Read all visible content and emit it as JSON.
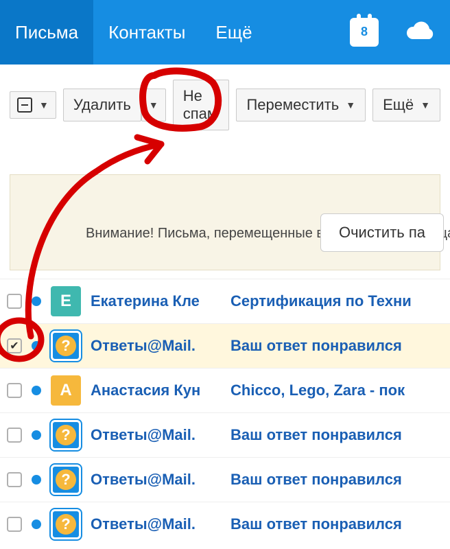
{
  "topnav": {
    "mails": "Письма",
    "contacts": "Контакты",
    "more": "Ещё",
    "calendar_day": "8"
  },
  "toolbar": {
    "delete_label": "Удалить",
    "notspam_label": "Не спам",
    "move_label": "Переместить",
    "more_label": "Ещё"
  },
  "panel": {
    "clear_label": "Очистить па",
    "warning": "Внимание! Письма, перемещенные в Спам более месяца"
  },
  "rows": [
    {
      "checked": false,
      "avatar_type": "teal",
      "avatar_letter": "Е",
      "sender": "Екатерина Кле",
      "subject": "Сертификация по Техни"
    },
    {
      "checked": true,
      "avatar_type": "q",
      "avatar_letter": "?",
      "sender": "Ответы@Mail.",
      "subject": "Ваш ответ понравился"
    },
    {
      "checked": false,
      "avatar_type": "amber",
      "avatar_letter": "А",
      "sender": "Анастасия Кун",
      "subject": "Chicco, Lego, Zara - пок"
    },
    {
      "checked": false,
      "avatar_type": "q",
      "avatar_letter": "?",
      "sender": "Ответы@Mail.",
      "subject": "Ваш ответ понравился"
    },
    {
      "checked": false,
      "avatar_type": "q",
      "avatar_letter": "?",
      "sender": "Ответы@Mail.",
      "subject": "Ваш ответ понравился"
    },
    {
      "checked": false,
      "avatar_type": "q",
      "avatar_letter": "?",
      "sender": "Ответы@Mail.",
      "subject": "Ваш ответ понравился"
    }
  ]
}
